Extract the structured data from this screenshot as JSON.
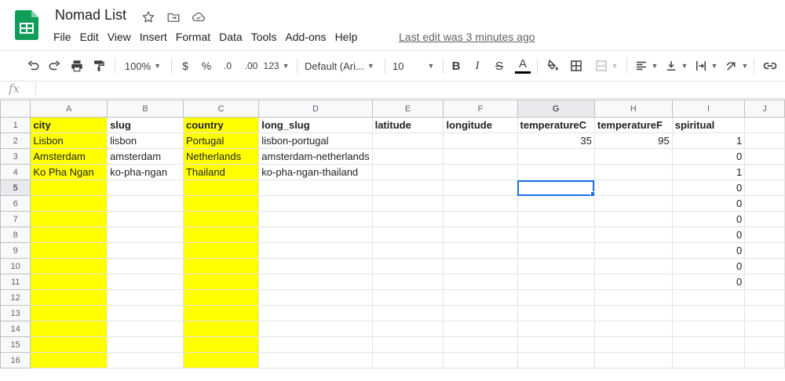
{
  "doc": {
    "title": "Nomad List",
    "last_edit": "Last edit was 3 minutes ago"
  },
  "menu": [
    "File",
    "Edit",
    "View",
    "Insert",
    "Format",
    "Data",
    "Tools",
    "Add-ons",
    "Help"
  ],
  "toolbar": {
    "zoom": "100%",
    "currency": "$",
    "percent": "%",
    "dec_decrease": ".0",
    "dec_increase": ".00",
    "more_formats": "123",
    "font": "Default (Ari...",
    "font_size": "10",
    "bold": "B",
    "italic": "I",
    "strike": "S",
    "text_color": "A"
  },
  "formula_bar": {
    "fx": "fx",
    "value": ""
  },
  "columns": [
    "A",
    "B",
    "C",
    "D",
    "E",
    "F",
    "G",
    "H",
    "I",
    "J"
  ],
  "rows": [
    {
      "n": "1",
      "cells": [
        "city",
        "slug",
        "country",
        "long_slug",
        "latitude",
        "longitude",
        "temperatureC",
        "temperatureF",
        "spiritual",
        ""
      ]
    },
    {
      "n": "2",
      "cells": [
        "Lisbon",
        "lisbon",
        "Portugal",
        "lisbon-portugal",
        "",
        "",
        "35",
        "95",
        "1",
        ""
      ]
    },
    {
      "n": "3",
      "cells": [
        "Amsterdam",
        "amsterdam",
        "Netherlands",
        "amsterdam-netherlands",
        "",
        "",
        "",
        "",
        "0",
        ""
      ]
    },
    {
      "n": "4",
      "cells": [
        "Ko Pha Ngan",
        "ko-pha-ngan",
        "Thailand",
        "ko-pha-ngan-thailand",
        "",
        "",
        "",
        "",
        "1",
        ""
      ]
    },
    {
      "n": "5",
      "cells": [
        "",
        "",
        "",
        "",
        "",
        "",
        "",
        "",
        "0",
        ""
      ]
    },
    {
      "n": "6",
      "cells": [
        "",
        "",
        "",
        "",
        "",
        "",
        "",
        "",
        "0",
        ""
      ]
    },
    {
      "n": "7",
      "cells": [
        "",
        "",
        "",
        "",
        "",
        "",
        "",
        "",
        "0",
        ""
      ]
    },
    {
      "n": "8",
      "cells": [
        "",
        "",
        "",
        "",
        "",
        "",
        "",
        "",
        "0",
        ""
      ]
    },
    {
      "n": "9",
      "cells": [
        "",
        "",
        "",
        "",
        "",
        "",
        "",
        "",
        "0",
        ""
      ]
    },
    {
      "n": "10",
      "cells": [
        "",
        "",
        "",
        "",
        "",
        "",
        "",
        "",
        "0",
        ""
      ]
    },
    {
      "n": "11",
      "cells": [
        "",
        "",
        "",
        "",
        "",
        "",
        "",
        "",
        "0",
        ""
      ]
    },
    {
      "n": "12",
      "cells": [
        "",
        "",
        "",
        "",
        "",
        "",
        "",
        "",
        "",
        ""
      ]
    },
    {
      "n": "13",
      "cells": [
        "",
        "",
        "",
        "",
        "",
        "",
        "",
        "",
        "",
        ""
      ]
    },
    {
      "n": "14",
      "cells": [
        "",
        "",
        "",
        "",
        "",
        "",
        "",
        "",
        "",
        ""
      ]
    },
    {
      "n": "15",
      "cells": [
        "",
        "",
        "",
        "",
        "",
        "",
        "",
        "",
        "",
        ""
      ]
    },
    {
      "n": "16",
      "cells": [
        "",
        "",
        "",
        "",
        "",
        "",
        "",
        "",
        "",
        ""
      ]
    }
  ],
  "selection": {
    "cell": "G5",
    "col": "G",
    "row": "5"
  },
  "colors": {
    "highlight": "#ffff00",
    "selection": "#1a73e8",
    "sheets_green": "#0f9d58"
  }
}
